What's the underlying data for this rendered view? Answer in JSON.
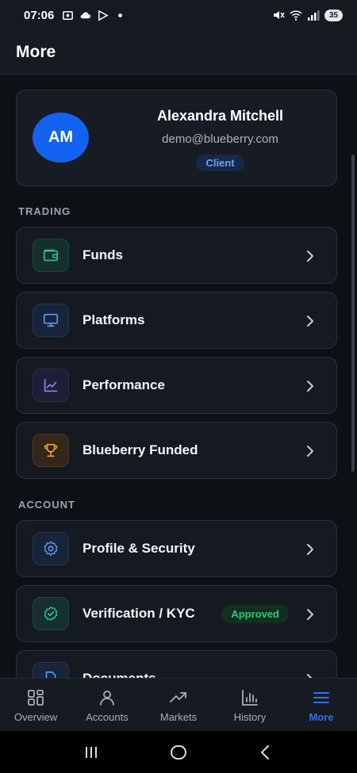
{
  "status_bar": {
    "time": "07:06",
    "battery": "35"
  },
  "header": {
    "title": "More"
  },
  "profile": {
    "initials": "AM",
    "name": "Alexandra Mitchell",
    "email": "demo@blueberry.com",
    "role": "Client"
  },
  "sections": {
    "trading": "TRADING",
    "account": "ACCOUNT"
  },
  "trading_items": [
    {
      "label": "Funds",
      "icon": "wallet-icon"
    },
    {
      "label": "Platforms",
      "icon": "monitor-icon"
    },
    {
      "label": "Performance",
      "icon": "chart-line-icon"
    },
    {
      "label": "Blueberry Funded",
      "icon": "trophy-icon"
    }
  ],
  "account_items": [
    {
      "label": "Profile & Security",
      "icon": "gear-icon"
    },
    {
      "label": "Verification / KYC",
      "icon": "shield-check-icon",
      "status": "Approved"
    },
    {
      "label": "Documents",
      "icon": "document-icon"
    }
  ],
  "bottom_nav": [
    {
      "label": "Overview",
      "icon": "grid-icon"
    },
    {
      "label": "Accounts",
      "icon": "user-icon"
    },
    {
      "label": "Markets",
      "icon": "trend-icon"
    },
    {
      "label": "History",
      "icon": "bar-chart-icon"
    },
    {
      "label": "More",
      "icon": "menu-icon",
      "active": true
    }
  ],
  "colors": {
    "background": "#0d1116",
    "accent": "#2f6ff0",
    "success": "#3cc477"
  }
}
